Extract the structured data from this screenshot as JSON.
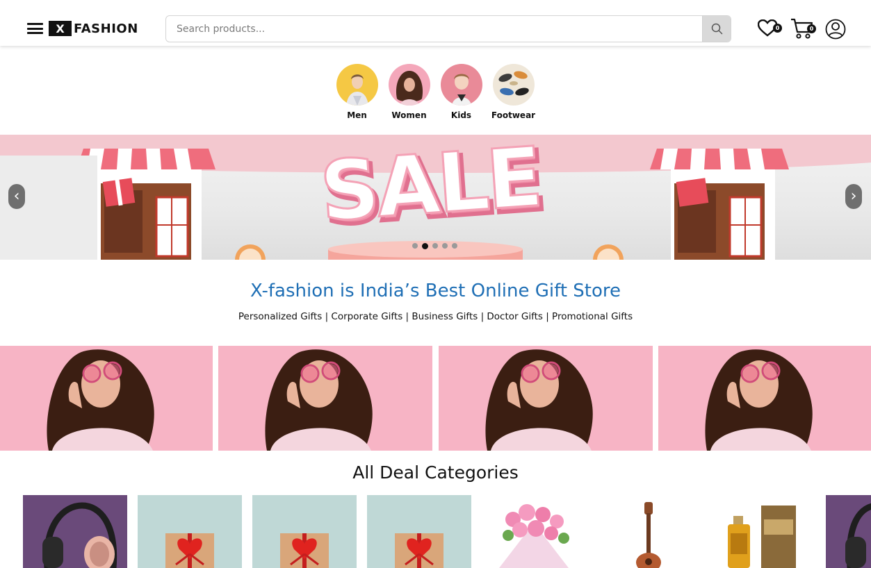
{
  "header": {
    "logo_mark": "X",
    "logo_text": "FASHION",
    "search_placeholder": "Search products...",
    "wishlist_count": "0",
    "cart_count": "0"
  },
  "categories": [
    {
      "label": "Men"
    },
    {
      "label": "Women"
    },
    {
      "label": "Kids"
    },
    {
      "label": "Footwear"
    }
  ],
  "banner": {
    "sale_text": "SALE",
    "prev_label": "‹",
    "next_label": "›",
    "slides": 5,
    "active_slide": 2
  },
  "tagline": {
    "headline": "X-fashion is India’s Best Online Gift Store",
    "subline": "Personalized Gifts | Corporate Gifts | Business Gifts | Doctor Gifts | Promotional Gifts"
  },
  "deals": {
    "title": "All Deal Categories"
  },
  "colors": {
    "headline": "#1f6fb5",
    "promo_bg": "#f7b4c5",
    "sale_pink": "#f08fa8"
  }
}
